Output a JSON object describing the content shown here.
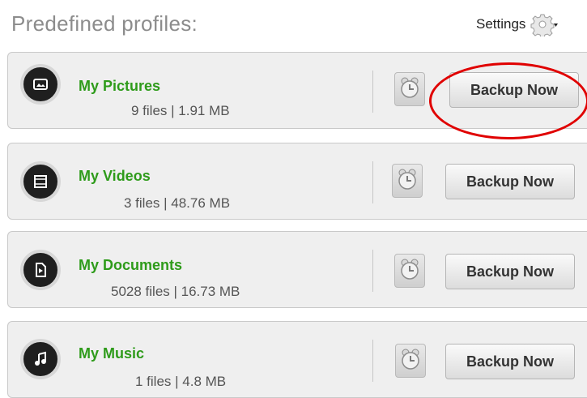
{
  "header": {
    "title": "Predefined profiles:",
    "settings_label": "Settings"
  },
  "icons": {
    "settings": "gear-icon",
    "schedule": "alarm-clock-icon",
    "pictures": "picture-icon",
    "videos": "film-icon",
    "documents": "document-icon",
    "music": "music-note-icon"
  },
  "colors": {
    "profile_name": "#2e9b1a",
    "highlight": "#e00000"
  },
  "profiles": [
    {
      "name": "My Pictures",
      "meta": "9 files | 1.91 MB",
      "backup_label": "Backup Now"
    },
    {
      "name": "My Videos",
      "meta": "3 files | 48.76 MB",
      "backup_label": "Backup Now"
    },
    {
      "name": "My Documents",
      "meta": "5028 files | 16.73 MB",
      "backup_label": "Backup Now"
    },
    {
      "name": "My Music",
      "meta": "1 files | 4.8 MB",
      "backup_label": "Backup Now"
    }
  ]
}
